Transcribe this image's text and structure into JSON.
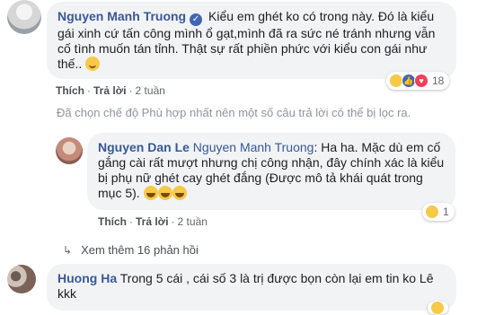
{
  "comments": [
    {
      "author": "Nguyen Manh Truong",
      "text": "Kiểu em ghét ko có trong này. Đó là kiểu gái xinh cứ tấn công mình ổ gạt,mình đã ra sức né tránh nhưng vẫn cố tình muốn tán tỉnh. Thật sự rất phiền phức với kiểu con gái như thế..",
      "actions": {
        "like": "Thích",
        "reply": "Trả lời",
        "time": "2 tuần"
      },
      "reaction_count": "18"
    },
    {
      "author": "Nguyen Dan Le",
      "mention": "Nguyen Manh Truong",
      "text": ": Ha ha. Mặc dù em cố gắng cài rất mượt nhưng chị công nhận, đây chính xác là kiểu bị phụ nữ ghét cay ghét đắng (Được mô tả khái quát trong mục 5).",
      "actions": {
        "like": "Thích",
        "reply": "Trả lời",
        "time": "2 tuần"
      },
      "reaction_count": "1"
    },
    {
      "author": "Huong Ha",
      "text": "Trong 5 cái , cái số 3 là trị được bọn còn lại em tin ko Lê kkk"
    }
  ],
  "filter_note": "Đã chọn chế độ Phù hợp nhất nên một số câu trả lời có thể bị lọc ra.",
  "more_replies": "Xem thêm 16 phản hồi",
  "icons": {
    "verified": "verified-badge-icon",
    "haha": "haha-reaction-icon",
    "like": "like-reaction-icon",
    "love": "love-reaction-icon",
    "reply_arrow": "reply-arrow-icon"
  },
  "colors": {
    "name": "#385898",
    "bubble": "#f2f3f5",
    "meta": "#606770",
    "verified": "#4267b2"
  }
}
